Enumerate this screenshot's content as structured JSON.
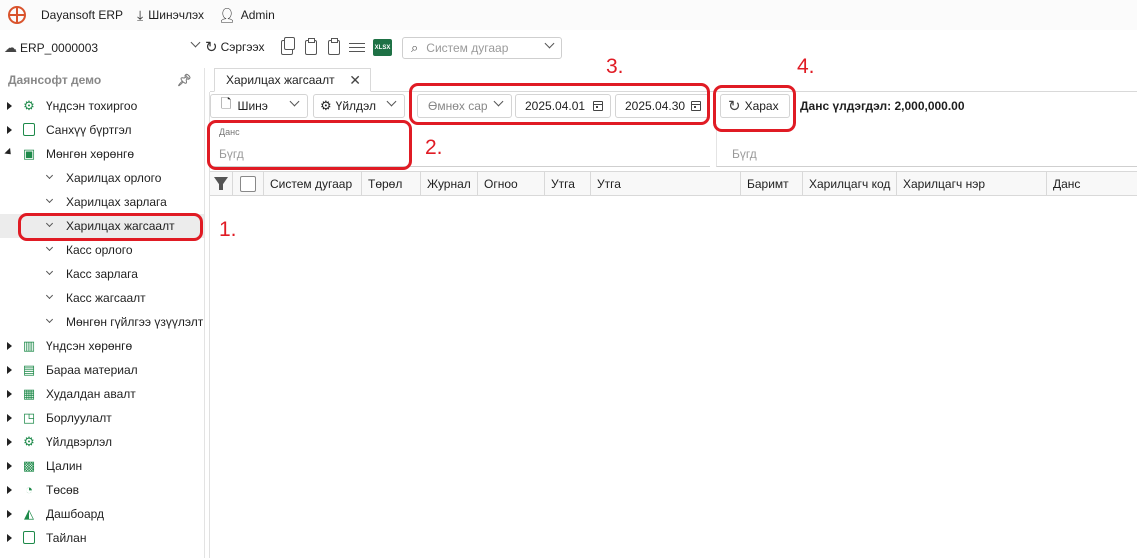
{
  "topbar": {
    "app_title": "Dayansoft ERP",
    "update_label": "Шинэчлэх",
    "user_label": "Admin"
  },
  "secondbar": {
    "erp_id": "ERP_0000003",
    "refresh_label": "Сэргээх",
    "search_placeholder": "Систем дугаар",
    "xlsx_label": "XLSX"
  },
  "sidebar": {
    "header": "Даянсофт демо",
    "items": [
      {
        "label": "Үндсэн тохиргоо",
        "icon": "gear-icon",
        "expanded": false
      },
      {
        "label": "Санхүү бүртгэл",
        "icon": "document-icon",
        "expanded": false
      },
      {
        "label": "Мөнгөн хөрөнгө",
        "icon": "money-icon",
        "expanded": true
      },
      {
        "label": "Үндсэн хөрөнгө",
        "icon": "building-icon",
        "expanded": false
      },
      {
        "label": "Бараа материал",
        "icon": "box-icon",
        "expanded": false
      },
      {
        "label": "Худалдан авалт",
        "icon": "cart-icon",
        "expanded": false
      },
      {
        "label": "Борлуулалт",
        "icon": "sale-icon",
        "expanded": false
      },
      {
        "label": "Үйлдвэрлэл",
        "icon": "factory-gear-icon",
        "expanded": false
      },
      {
        "label": "Цалин",
        "icon": "calculator-icon",
        "expanded": false
      },
      {
        "label": "Төсөв",
        "icon": "pie-chart-icon",
        "expanded": false
      },
      {
        "label": "Дашбоард",
        "icon": "area-chart-icon",
        "expanded": false
      },
      {
        "label": "Тайлан",
        "icon": "report-icon",
        "expanded": false
      }
    ],
    "money_children": [
      "Харилцах орлого",
      "Харилцах зарлага",
      "Харилцах жагсаалт",
      "Касс орлого",
      "Касс зарлага",
      "Касс жагсаалт",
      "Мөнгөн гүйлгээ үзүүлэлт"
    ],
    "selected_child": "Харилцах жагсаалт"
  },
  "tab": {
    "label": "Харилцах жагсаалт"
  },
  "toolbar": {
    "new_label": "Шинэ",
    "production_label": "Үйлдэл",
    "period_label": "Өмнөх сар",
    "date_from": "2025.04.01",
    "date_to": "2025.04.30",
    "view_label": "Харах",
    "balance_label": "Данс үлдэгдэл: 2,000,000.00"
  },
  "filters": {
    "account_label": "Данс",
    "account_value": "Бүгд",
    "second_value": "Бүгд"
  },
  "grid": {
    "columns": [
      "Систем дугаар",
      "Төрөл",
      "Журнал",
      "Огноо",
      "Утга",
      "Утга",
      "Баримт",
      "Харилцагч код",
      "Харилцагч нэр",
      "Данс"
    ]
  },
  "annotations": [
    "1.",
    "2.",
    "3.",
    "4."
  ],
  "colors": {
    "annotation": "#e01b24",
    "icon_green": "#1e8a4a",
    "logo": "#d9532c"
  }
}
